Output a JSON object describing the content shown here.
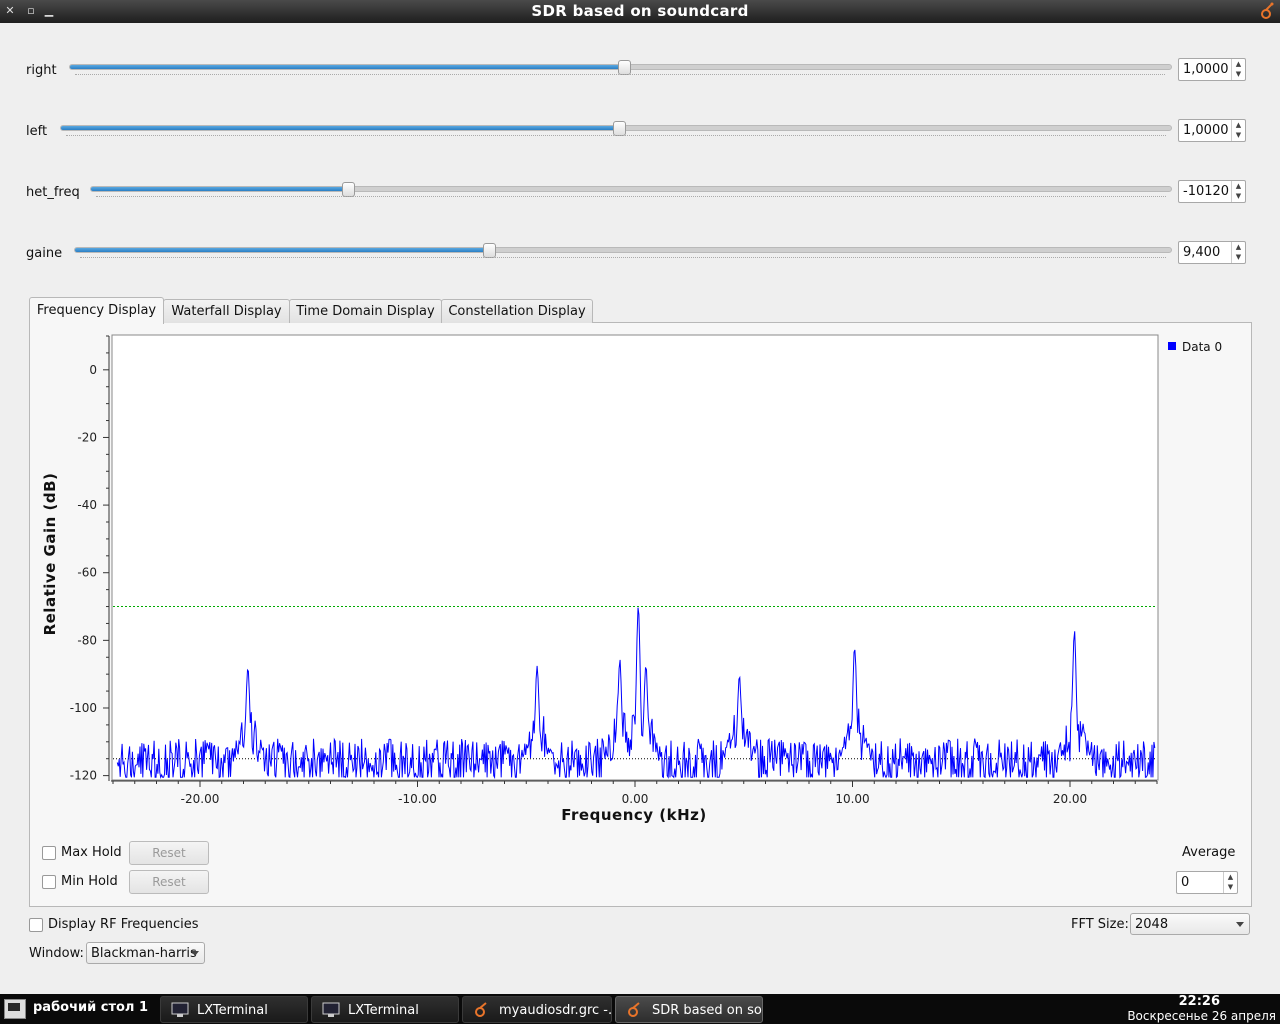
{
  "window": {
    "title": "SDR based on soundcard"
  },
  "sliders": [
    {
      "label": "right",
      "value": "1,0000",
      "fraction": 0.5
    },
    {
      "label": "left",
      "value": "1,0000",
      "fraction": 0.5
    },
    {
      "label": "het_freq",
      "value": "-10120",
      "fraction": 0.24
    },
    {
      "label": "gaine",
      "value": "9,400",
      "fraction": 0.44
    }
  ],
  "tabs": [
    {
      "label": "Frequency Display",
      "active": true
    },
    {
      "label": "Waterfall Display",
      "active": false
    },
    {
      "label": "Time Domain Display",
      "active": false
    },
    {
      "label": "Constellation Display",
      "active": false
    }
  ],
  "chart_data": {
    "type": "line",
    "xlabel": "Frequency (kHz)",
    "ylabel": "Relative Gain (dB)",
    "xlim": [
      -24,
      24
    ],
    "ylim": [
      -121,
      10
    ],
    "yticks": [
      "0",
      "-20",
      "-40",
      "-60",
      "-80",
      "-100",
      "-120"
    ],
    "xticks": [
      "-20.00",
      "-10.00",
      "0.00",
      "10.00",
      "20.00"
    ],
    "series": [
      {
        "name": "Data 0",
        "color": "#0000ff",
        "noise_floor": -116,
        "peaks": [
          {
            "x": -17.8,
            "y": -88
          },
          {
            "x": -4.5,
            "y": -88
          },
          {
            "x": -0.7,
            "y": -86
          },
          {
            "x": 0.15,
            "y": -70
          },
          {
            "x": 0.5,
            "y": -88
          },
          {
            "x": 4.8,
            "y": -91
          },
          {
            "x": 10.1,
            "y": -82
          },
          {
            "x": 20.2,
            "y": -78
          }
        ]
      }
    ],
    "threshold_line": {
      "y": -70,
      "color": "#00aa00"
    },
    "avg_line": {
      "y": -115,
      "color": "#000000"
    },
    "legend_position": "top-right"
  },
  "controls": {
    "max_hold": "Max Hold",
    "min_hold": "Min Hold",
    "reset": "Reset",
    "average_label": "Average",
    "average_value": "0",
    "display_rf": "Display RF Frequencies",
    "fft_label": "FFT Size:",
    "fft_value": "2048",
    "window_label": "Window:",
    "window_value": "Blackman-harris"
  },
  "taskbar": {
    "desktop": "рабочий стол 1",
    "items": [
      {
        "label": "LXTerminal",
        "icon": "terminal-icon",
        "active": false
      },
      {
        "label": "LXTerminal",
        "icon": "terminal-icon",
        "active": false
      },
      {
        "label": "myaudiosdr.grc -...",
        "icon": "gnuradio-icon",
        "active": false
      },
      {
        "label": "SDR based on so...",
        "icon": "gnuradio-icon",
        "active": true
      }
    ],
    "time": "22:26",
    "date": "Воскресенье 26 апреля"
  }
}
